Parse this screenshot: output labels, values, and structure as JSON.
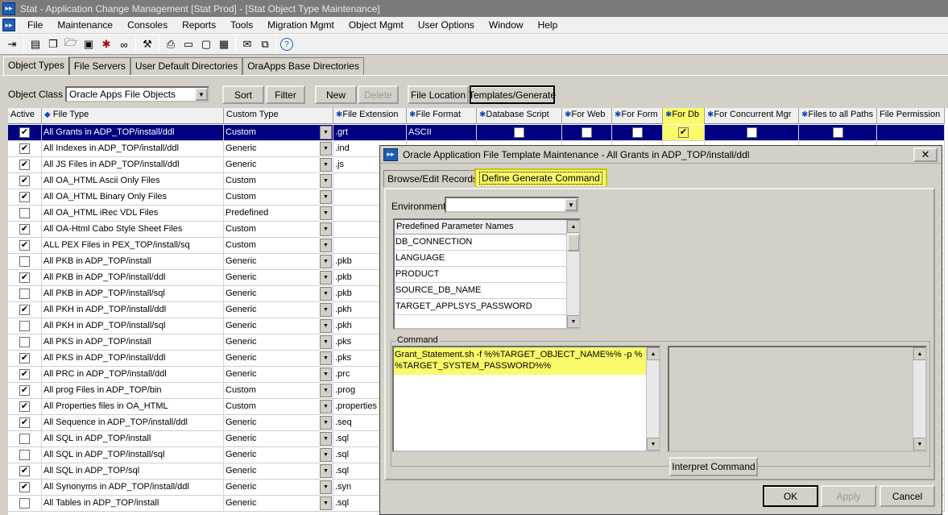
{
  "window": {
    "title": "Stat - Application Change Management   [Stat Prod] - [Stat Object Type Maintenance]"
  },
  "menu": [
    "File",
    "Maintenance",
    "Consoles",
    "Reports",
    "Tools",
    "Migration Mgmt",
    "Object Mgmt",
    "User Options",
    "Window",
    "Help"
  ],
  "toolbar_icons": [
    "exit-icon",
    "new-doc-icon",
    "copy-icon",
    "open-folder-icon",
    "save-icon",
    "bug-icon",
    "binoculars-icon",
    "wrench-icon",
    "printer-icon",
    "document-icon",
    "window-icon",
    "calendar-icon",
    "chat-icon",
    "window-stack-icon",
    "help-icon"
  ],
  "tabs": [
    "Object Types",
    "File Servers",
    "User Default Directories",
    "OraApps Base Directories"
  ],
  "object_class": {
    "label": "Object Class",
    "value": "Oracle Apps File Objects"
  },
  "buttons": {
    "sort": "Sort",
    "filter": "Filter",
    "new": "New",
    "delete": "Delete",
    "file_location": "File Location",
    "templates": "Templates/Generate"
  },
  "grid": {
    "columns": [
      "Active",
      "File Type",
      "Custom Type",
      "File Extension",
      "File Format",
      "Database Script",
      "For Web",
      "For Form",
      "For Db",
      "For Concurrent Mgr",
      "Files to all Paths",
      "File Permission"
    ],
    "rows": [
      {
        "active": true,
        "file_type": "All Grants in ADP_TOP/install/ddl",
        "custom_type": "Custom",
        "ext": ".grt",
        "format": "ASCII"
      },
      {
        "active": true,
        "file_type": "All Indexes in ADP_TOP/install/ddl",
        "custom_type": "Generic",
        "ext": ".ind",
        "format": ""
      },
      {
        "active": true,
        "file_type": "All JS Files in ADP_TOP/install/ddl",
        "custom_type": "Generic",
        "ext": ".js",
        "format": ""
      },
      {
        "active": true,
        "file_type": "All OA_HTML Ascii Only Files",
        "custom_type": "Custom",
        "ext": "",
        "format": ""
      },
      {
        "active": true,
        "file_type": "All OA_HTML Binary Only Files",
        "custom_type": "Custom",
        "ext": "",
        "format": ""
      },
      {
        "active": false,
        "file_type": "All OA_HTML iRec VDL Files",
        "custom_type": "Predefined",
        "ext": "",
        "format": ""
      },
      {
        "active": true,
        "file_type": "All OA-Html Cabo Style Sheet Files",
        "custom_type": "Custom",
        "ext": "",
        "format": ""
      },
      {
        "active": true,
        "file_type": "ALL PEX Files in PEX_TOP/install/sq",
        "custom_type": "Custom",
        "ext": "",
        "format": ""
      },
      {
        "active": false,
        "file_type": "All PKB in ADP_TOP/install",
        "custom_type": "Generic",
        "ext": ".pkb",
        "format": ""
      },
      {
        "active": true,
        "file_type": "All PKB in ADP_TOP/install/ddl",
        "custom_type": "Generic",
        "ext": ".pkb",
        "format": ""
      },
      {
        "active": false,
        "file_type": "All PKB in ADP_TOP/install/sql",
        "custom_type": "Generic",
        "ext": ".pkb",
        "format": ""
      },
      {
        "active": true,
        "file_type": "All PKH in ADP_TOP/install/ddl",
        "custom_type": "Generic",
        "ext": ".pkh",
        "format": ""
      },
      {
        "active": false,
        "file_type": "All PKH in ADP_TOP/install/sql",
        "custom_type": "Generic",
        "ext": ".pkh",
        "format": ""
      },
      {
        "active": false,
        "file_type": "All PKS in ADP_TOP/install",
        "custom_type": "Generic",
        "ext": ".pks",
        "format": ""
      },
      {
        "active": true,
        "file_type": "All PKS in ADP_TOP/install/ddl",
        "custom_type": "Generic",
        "ext": ".pks",
        "format": ""
      },
      {
        "active": true,
        "file_type": "All PRC in ADP_TOP/install/ddl",
        "custom_type": "Generic",
        "ext": ".prc",
        "format": ""
      },
      {
        "active": true,
        "file_type": "All prog Files in ADP_TOP/bin",
        "custom_type": "Custom",
        "ext": ".prog",
        "format": ""
      },
      {
        "active": true,
        "file_type": "All Properties files in OA_HTML",
        "custom_type": "Custom",
        "ext": ".properties",
        "format": ""
      },
      {
        "active": true,
        "file_type": "All Sequence in ADP_TOP/install/ddl",
        "custom_type": "Generic",
        "ext": ".seq",
        "format": ""
      },
      {
        "active": false,
        "file_type": "All SQL in ADP_TOP/install",
        "custom_type": "Generic",
        "ext": ".sql",
        "format": ""
      },
      {
        "active": false,
        "file_type": "All SQL in ADP_TOP/install/sql",
        "custom_type": "Generic",
        "ext": ".sql",
        "format": ""
      },
      {
        "active": true,
        "file_type": "All SQL in ADP_TOP/sql",
        "custom_type": "Generic",
        "ext": ".sql",
        "format": ""
      },
      {
        "active": true,
        "file_type": "All Synonyms in ADP_TOP/install/ddl",
        "custom_type": "Generic",
        "ext": ".syn",
        "format": ""
      },
      {
        "active": false,
        "file_type": "All Tables in ADP_TOP/install",
        "custom_type": "Generic",
        "ext": ".sql",
        "format": ""
      }
    ]
  },
  "dialog": {
    "title": "Oracle Application File Template Maintenance - All Grants in ADP_TOP/install/ddl",
    "tabs": [
      "Browse/Edit Records",
      "Define Generate Command"
    ],
    "environment_label": "Environment",
    "environment_value": "",
    "param_header": "Predefined Parameter Names",
    "params": [
      "DB_CONNECTION",
      "LANGUAGE",
      "PRODUCT",
      "SOURCE_DB_NAME",
      "TARGET_APPLSYS_PASSWORD"
    ],
    "command_label": "Command",
    "command_line1": "Grant_Statement.sh  -f %%TARGET_OBJECT_NAME%% -p %",
    "command_line2": "%TARGET_SYSTEM_PASSWORD%%",
    "interpret": "Interpret Command",
    "ok": "OK",
    "apply": "Apply",
    "cancel": "Cancel"
  }
}
